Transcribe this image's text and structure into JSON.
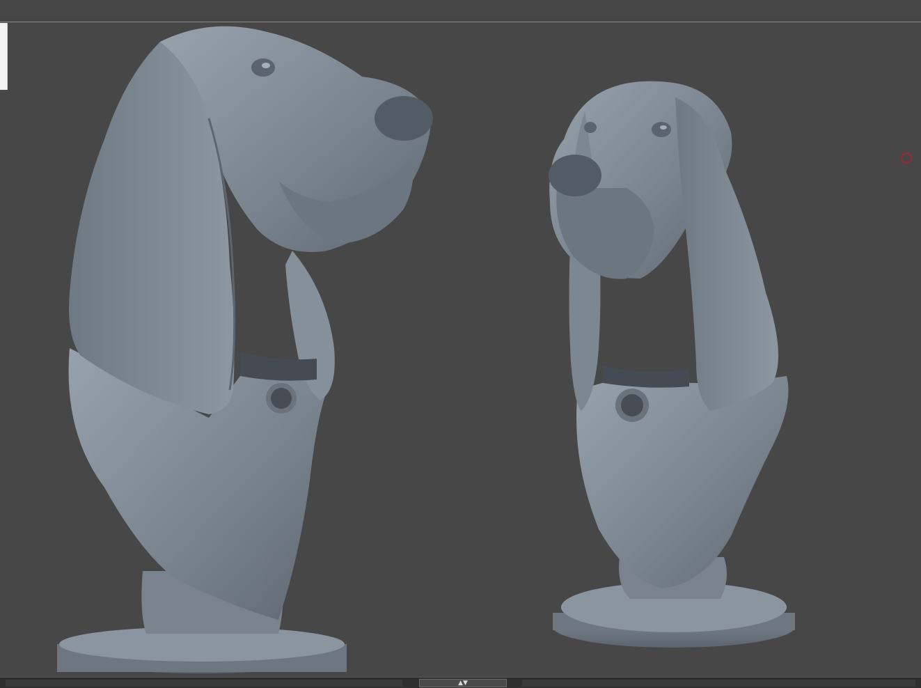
{
  "app": {
    "viewport_background": "#474747",
    "model_color": "#7b8590"
  },
  "icons": {
    "left_panel_tab": "panel-toggle-icon",
    "cursor": "brush-cursor-icon",
    "bottom_handle": "expand-arrows-icon"
  },
  "bottom_bar": {
    "handle_glyph": "▲▼"
  }
}
